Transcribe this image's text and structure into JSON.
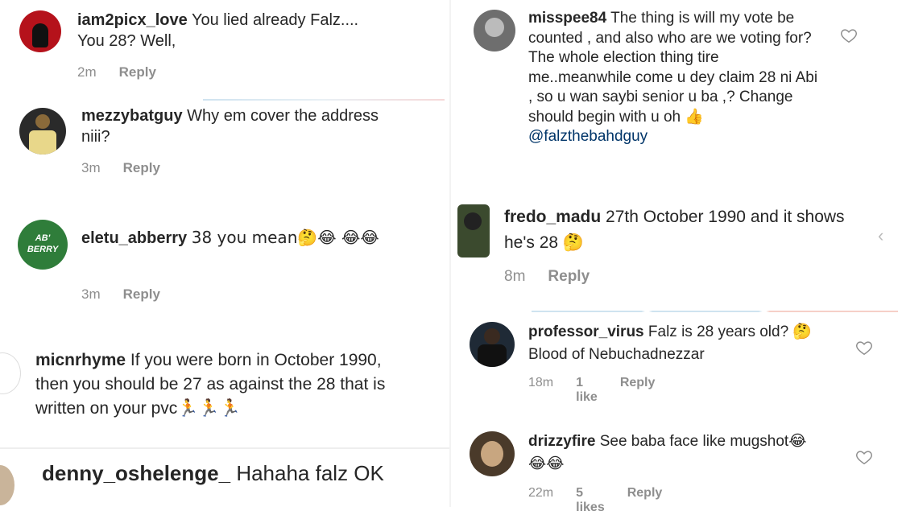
{
  "left": [
    {
      "user": "iam2picx_love",
      "text": "You lied already Falz.... You 28? Well,",
      "time": "2m",
      "reply": "Reply",
      "avatar_color": "#b5121b"
    },
    {
      "user": "mezzybatguy",
      "text": "Why em cover the address niii?",
      "time": "3m",
      "reply": "Reply",
      "avatar_color": "#2a2a2a"
    },
    {
      "user": "eletu_abberry",
      "text": "38 you mean🤔😂 😂😂",
      "time": "3m",
      "reply": "Reply",
      "avatar_color": "#2f7d3a",
      "avatar_text": "AB BERRY"
    },
    {
      "user": "micnrhyme",
      "text": "If you were born in October 1990, then you should be 27 as against the 28 that is written on your pvc🏃🏃🏃"
    },
    {
      "user": "denny_oshelenge_",
      "text": "Hahaha falz OK"
    }
  ],
  "right": [
    {
      "user": "misspee84",
      "text": "The thing is will my vote be counted , and also who are we voting for? The whole election thing tire me..meanwhile come u dey claim 28 ni Abi , so u wan saybi senior u ba ,? Change should begin with u oh 👍",
      "mention": "@falzthebahdguy",
      "avatar_color": "#6e6e6e"
    },
    {
      "user": "fredo_madu",
      "text": "27th October 1990 and it shows he's 28 🤔",
      "time": "8m",
      "reply": "Reply",
      "avatar_color": "#3b4a2e"
    },
    {
      "user": "professor_virus",
      "text": "Falz is 28 years old? 🤔 Blood of Nebuchadnezzar",
      "time": "18m",
      "likes": "1 like",
      "reply": "Reply",
      "avatar_color": "#1f2a36"
    },
    {
      "user": "drizzyfire",
      "text": "See baba face like mugshot😂😂😂",
      "time": "22m",
      "likes": "5 likes",
      "reply": "Reply",
      "avatar_color": "#4a3a2a"
    }
  ]
}
